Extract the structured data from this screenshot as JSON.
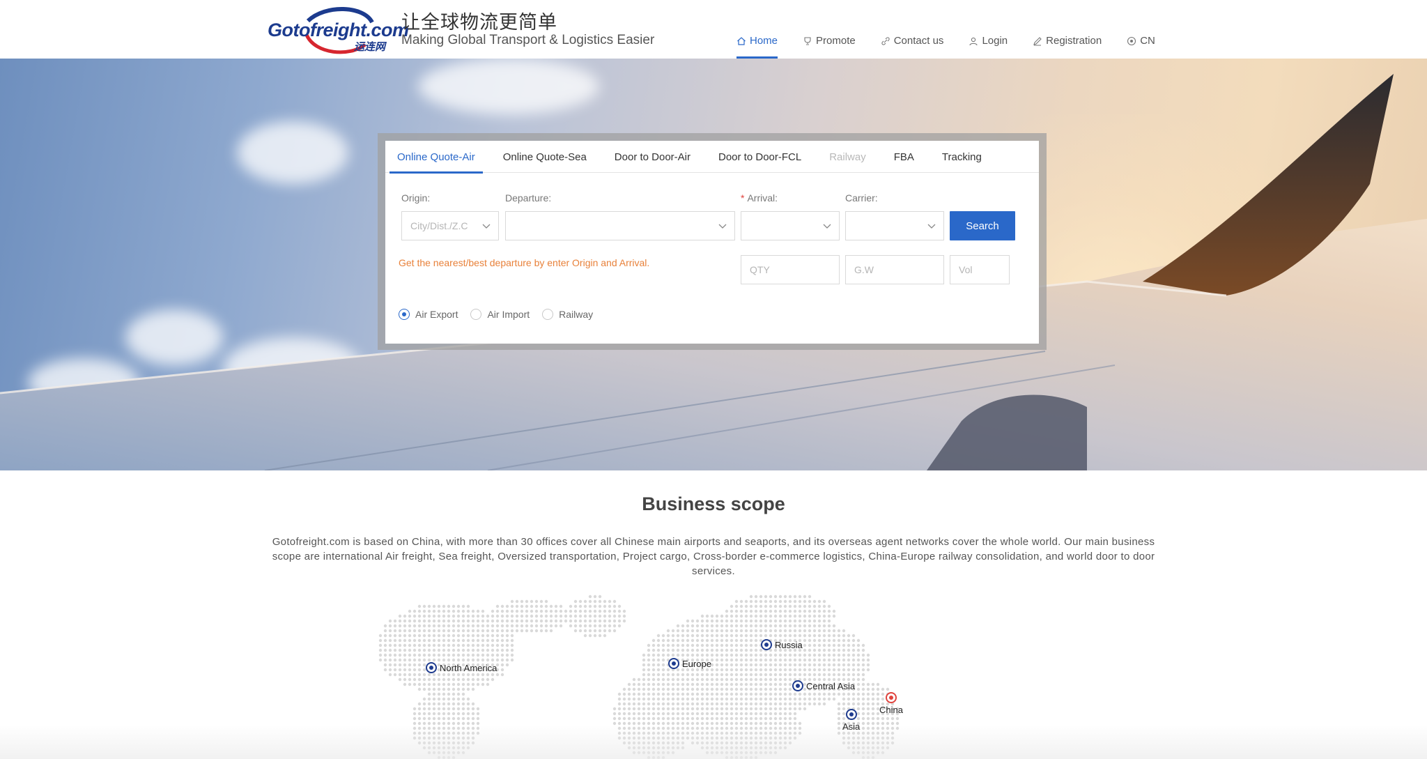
{
  "header": {
    "logo_text_main": "Gotofreight.com",
    "logo_text_cn": "运连网",
    "slogan_cn": "让全球物流更简单",
    "slogan_en": "Making Global Transport & Logistics Easier",
    "nav": [
      {
        "label": "Home",
        "icon": "home-icon",
        "active": true
      },
      {
        "label": "Promote",
        "icon": "trophy-icon"
      },
      {
        "label": "Contact us",
        "icon": "link-icon"
      },
      {
        "label": "Login",
        "icon": "user-icon"
      },
      {
        "label": "Registration",
        "icon": "pencil-icon"
      },
      {
        "label": "CN",
        "icon": "language-icon"
      }
    ]
  },
  "quote": {
    "tabs": [
      {
        "label": "Online Quote-Air",
        "active": true
      },
      {
        "label": "Online Quote-Sea"
      },
      {
        "label": "Door to Door-Air"
      },
      {
        "label": "Door to Door-FCL"
      },
      {
        "label": "Railway",
        "disabled": true
      },
      {
        "label": "FBA"
      },
      {
        "label": "Tracking"
      }
    ],
    "origin_label": "Origin:",
    "origin_placeholder": "City/Dist./Z.C",
    "departure_label": "Departure:",
    "departure_value": "",
    "arrival_label": "Arrival:",
    "arrival_required_mark": "*",
    "arrival_value": "",
    "carrier_label": "Carrier:",
    "carrier_value": "",
    "search_label": "Search",
    "hint": "Get the nearest/best departure by enter Origin and Arrival.",
    "qty_placeholder": "QTY",
    "gw_placeholder": "G.W",
    "vol_placeholder": "Vol",
    "radios": [
      {
        "label": "Air Export",
        "checked": true
      },
      {
        "label": "Air Import",
        "checked": false
      },
      {
        "label": "Railway",
        "checked": false
      }
    ]
  },
  "scope": {
    "title": "Business scope",
    "text": "Gotofreight.com is based on China, with more than 30 offices cover all Chinese main airports and seaports, and its overseas agent networks cover the whole world. Our main business scope are international Air freight, Sea freight, Oversized transportation, Project cargo, Cross-border e-commerce logistics, China-Europe railway consolidation, and world door to door services."
  },
  "map_markers": [
    {
      "label": "North America"
    },
    {
      "label": "Europe"
    },
    {
      "label": "Russia"
    },
    {
      "label": "Central Asia"
    },
    {
      "label": "China",
      "highlight": true
    },
    {
      "label": "Asia"
    }
  ],
  "colors": {
    "accent": "#2a68c9",
    "brand_blue": "#1c3b8e",
    "brand_red": "#d6262f",
    "hint_orange": "#e8813a",
    "marker_red": "#e0433d"
  }
}
